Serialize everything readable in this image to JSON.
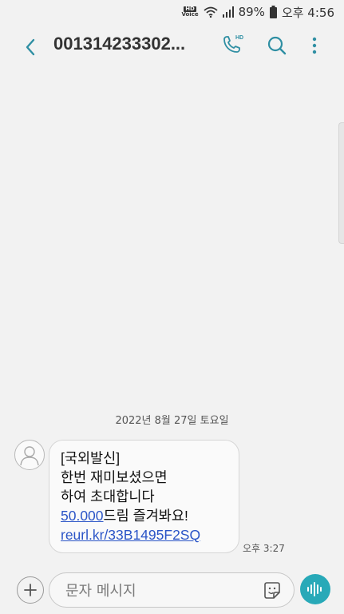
{
  "status_bar": {
    "hd_label": "HD",
    "voice_label": "Voice",
    "battery": "89%",
    "time": "오후 4:56"
  },
  "header": {
    "title": "001314233302...",
    "call_badge": "HD"
  },
  "conversation": {
    "date": "2022년 8월 27일 토요일",
    "messages": [
      {
        "lines": [
          "[국외발신]",
          "한번 재미보셨으면",
          "하여 초대합니다"
        ],
        "amount_link": "50.000",
        "amount_suffix": "드림 즐겨봐요!",
        "url_link": "reurl.kr/33B1495F2SQ",
        "time": "오후 3:27"
      }
    ]
  },
  "compose": {
    "placeholder": "문자 메시지"
  },
  "colors": {
    "background": "#f2f2f2",
    "accent": "#28a9b8",
    "link": "#2b55c7"
  }
}
